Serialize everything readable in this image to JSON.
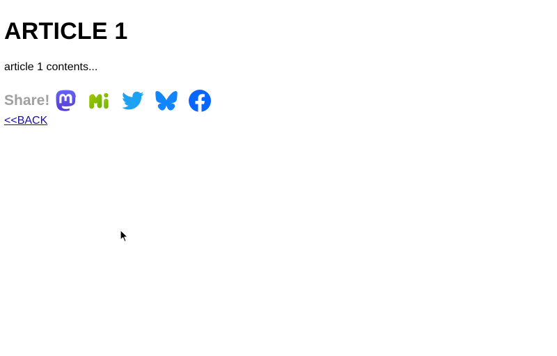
{
  "article": {
    "title": "ARTICLE 1",
    "contents": "article 1 contents..."
  },
  "share": {
    "label": "Share!",
    "buttons": [
      {
        "name": "mastodon",
        "icon": "mastodon-icon",
        "color": "#5B4BE1"
      },
      {
        "name": "misskey",
        "icon": "misskey-icon",
        "color": "#86B300"
      },
      {
        "name": "twitter",
        "icon": "twitter-icon",
        "color": "#1DA1F2"
      },
      {
        "name": "bluesky",
        "icon": "bluesky-icon",
        "color": "#1185FE"
      },
      {
        "name": "facebook",
        "icon": "facebook-icon",
        "color": "#0866FF"
      }
    ]
  },
  "nav": {
    "back_label": "<<BACK"
  },
  "colors": {
    "link": "#1a0dab",
    "share_label": "#a0a0a0"
  }
}
